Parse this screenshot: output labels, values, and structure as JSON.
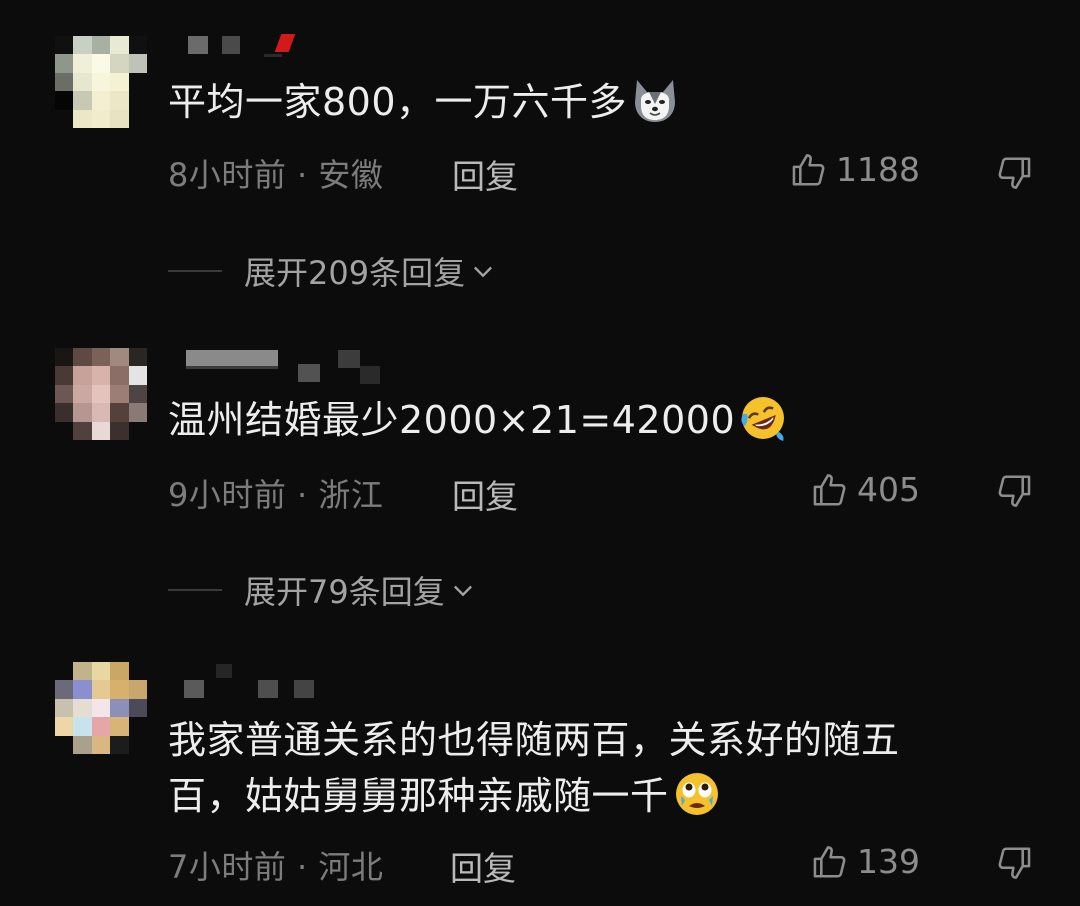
{
  "comments": [
    {
      "text": "平均一家800，一万六千多",
      "emoji": "husky-dog-emoji",
      "meta": "8小时前 · 安徽",
      "reply_label": "回复",
      "likes": "1188",
      "expand_label": "展开209条回复"
    },
    {
      "text": "温州结婚最少2000×21=42000",
      "emoji": "rolling-laughing-emoji",
      "meta": "9小时前 · 浙江",
      "reply_label": "回复",
      "likes": "405",
      "expand_label": "展开79条回复"
    },
    {
      "text_line1": "我家普通关系的也得随两百，关系好的随五",
      "text_line2": "百，姑姑舅舅那种亲戚随一千",
      "emoji": "teary-eyed-emoji",
      "meta": "7小时前 · 河北",
      "reply_label": "回复",
      "likes": "139"
    }
  ],
  "colors": {
    "background": "#0c0c0c",
    "text": "#ededed",
    "meta": "#7c7c7c",
    "reply": "#b9b9b9"
  }
}
